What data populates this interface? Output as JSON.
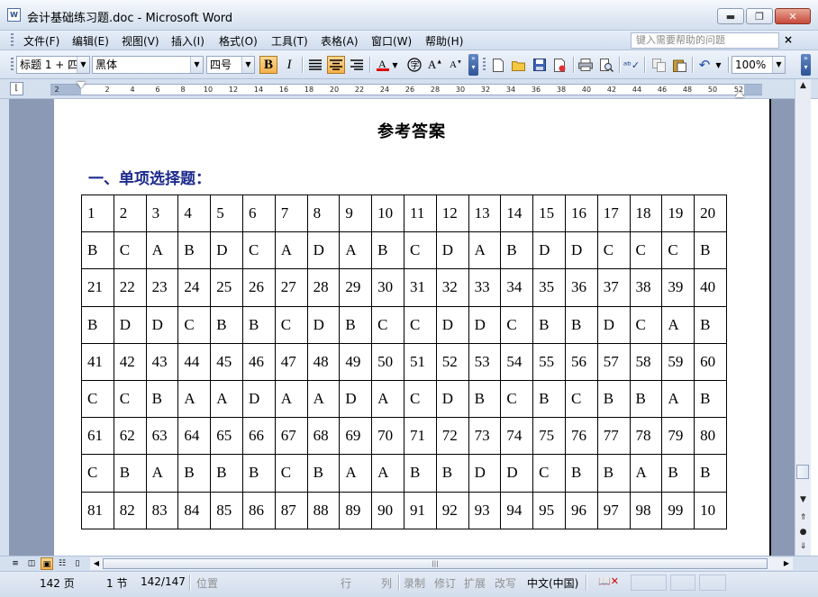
{
  "window": {
    "title": "会计基础练习题.doc - Microsoft Word",
    "app_icon": "word-doc-icon",
    "minimize_glyph": "▬",
    "restore_glyph": "❐",
    "close_glyph": "✕"
  },
  "menubar": {
    "items": [
      "文件(F)",
      "编辑(E)",
      "视图(V)",
      "插入(I)",
      "格式(O)",
      "工具(T)",
      "表格(A)",
      "窗口(W)",
      "帮助(H)"
    ],
    "help_placeholder": "键入需要帮助的问题",
    "doc_close_glyph": "×"
  },
  "toolbar": {
    "style": "标题 1 + 四",
    "font": "黑体",
    "size": "四号",
    "bold": "B",
    "italic": "I",
    "zoom": "100%",
    "icons": [
      "align-left-icon",
      "align-center-icon",
      "justify-icon",
      "font-color-icon",
      "phonetic-guide-icon",
      "grow-font-icon",
      "shrink-font-icon",
      "new-doc-icon",
      "open-icon",
      "save-icon",
      "permission-icon",
      "print-icon",
      "print-preview-icon",
      "spelling-icon",
      "copy-icon",
      "paste-icon",
      "undo-icon"
    ],
    "active": [
      "bold",
      "align-center"
    ]
  },
  "ruler": {
    "ticks": [
      "2",
      "2",
      "4",
      "6",
      "8",
      "10",
      "12",
      "14",
      "16",
      "18",
      "20",
      "22",
      "24",
      "26",
      "28",
      "30",
      "32",
      "34",
      "36",
      "38",
      "40",
      "42",
      "44",
      "46",
      "48",
      "50",
      "52"
    ]
  },
  "document": {
    "title": "参考答案",
    "section_heading": "一、单项选择题：",
    "table": [
      [
        "1",
        "2",
        "3",
        "4",
        "5",
        "6",
        "7",
        "8",
        "9",
        "10",
        "11",
        "12",
        "13",
        "14",
        "15",
        "16",
        "17",
        "18",
        "19",
        "20"
      ],
      [
        "B",
        "C",
        "A",
        "B",
        "D",
        "C",
        "A",
        "D",
        "A",
        "B",
        "C",
        "D",
        "A",
        "B",
        "D",
        "D",
        "C",
        "C",
        "C",
        "B"
      ],
      [
        "21",
        "22",
        "23",
        "24",
        "25",
        "26",
        "27",
        "28",
        "29",
        "30",
        "31",
        "32",
        "33",
        "34",
        "35",
        "36",
        "37",
        "38",
        "39",
        "40"
      ],
      [
        "B",
        "D",
        "D",
        "C",
        "B",
        "B",
        "C",
        "D",
        "B",
        "C",
        "C",
        "D",
        "D",
        "C",
        "B",
        "B",
        "D",
        "C",
        "A",
        "B"
      ],
      [
        "41",
        "42",
        "43",
        "44",
        "45",
        "46",
        "47",
        "48",
        "49",
        "50",
        "51",
        "52",
        "53",
        "54",
        "55",
        "56",
        "57",
        "58",
        "59",
        "60"
      ],
      [
        "C",
        "C",
        "B",
        "A",
        "A",
        "D",
        "A",
        "A",
        "D",
        "A",
        "C",
        "D",
        "B",
        "C",
        "B",
        "C",
        "B",
        "B",
        "A",
        "B"
      ],
      [
        "61",
        "62",
        "63",
        "64",
        "65",
        "66",
        "67",
        "68",
        "69",
        "70",
        "71",
        "72",
        "73",
        "74",
        "75",
        "76",
        "77",
        "78",
        "79",
        "80"
      ],
      [
        "C",
        "B",
        "A",
        "B",
        "B",
        "B",
        "C",
        "B",
        "A",
        "A",
        "B",
        "B",
        "D",
        "D",
        "C",
        "B",
        "B",
        "A",
        "B",
        "B"
      ],
      [
        "81",
        "82",
        "83",
        "84",
        "85",
        "86",
        "87",
        "88",
        "89",
        "90",
        "91",
        "92",
        "93",
        "94",
        "95",
        "96",
        "97",
        "98",
        "99",
        "10"
      ]
    ]
  },
  "statusbar": {
    "page": "142 页",
    "section": "1 节",
    "page_of": "142/147",
    "position": "位置",
    "line": "行",
    "column": "列",
    "record": "录制",
    "revise": "修订",
    "extend": "扩展",
    "overtype": "改写",
    "language": "中文(中国)",
    "spelling_icon": "spelling-status-icon"
  }
}
